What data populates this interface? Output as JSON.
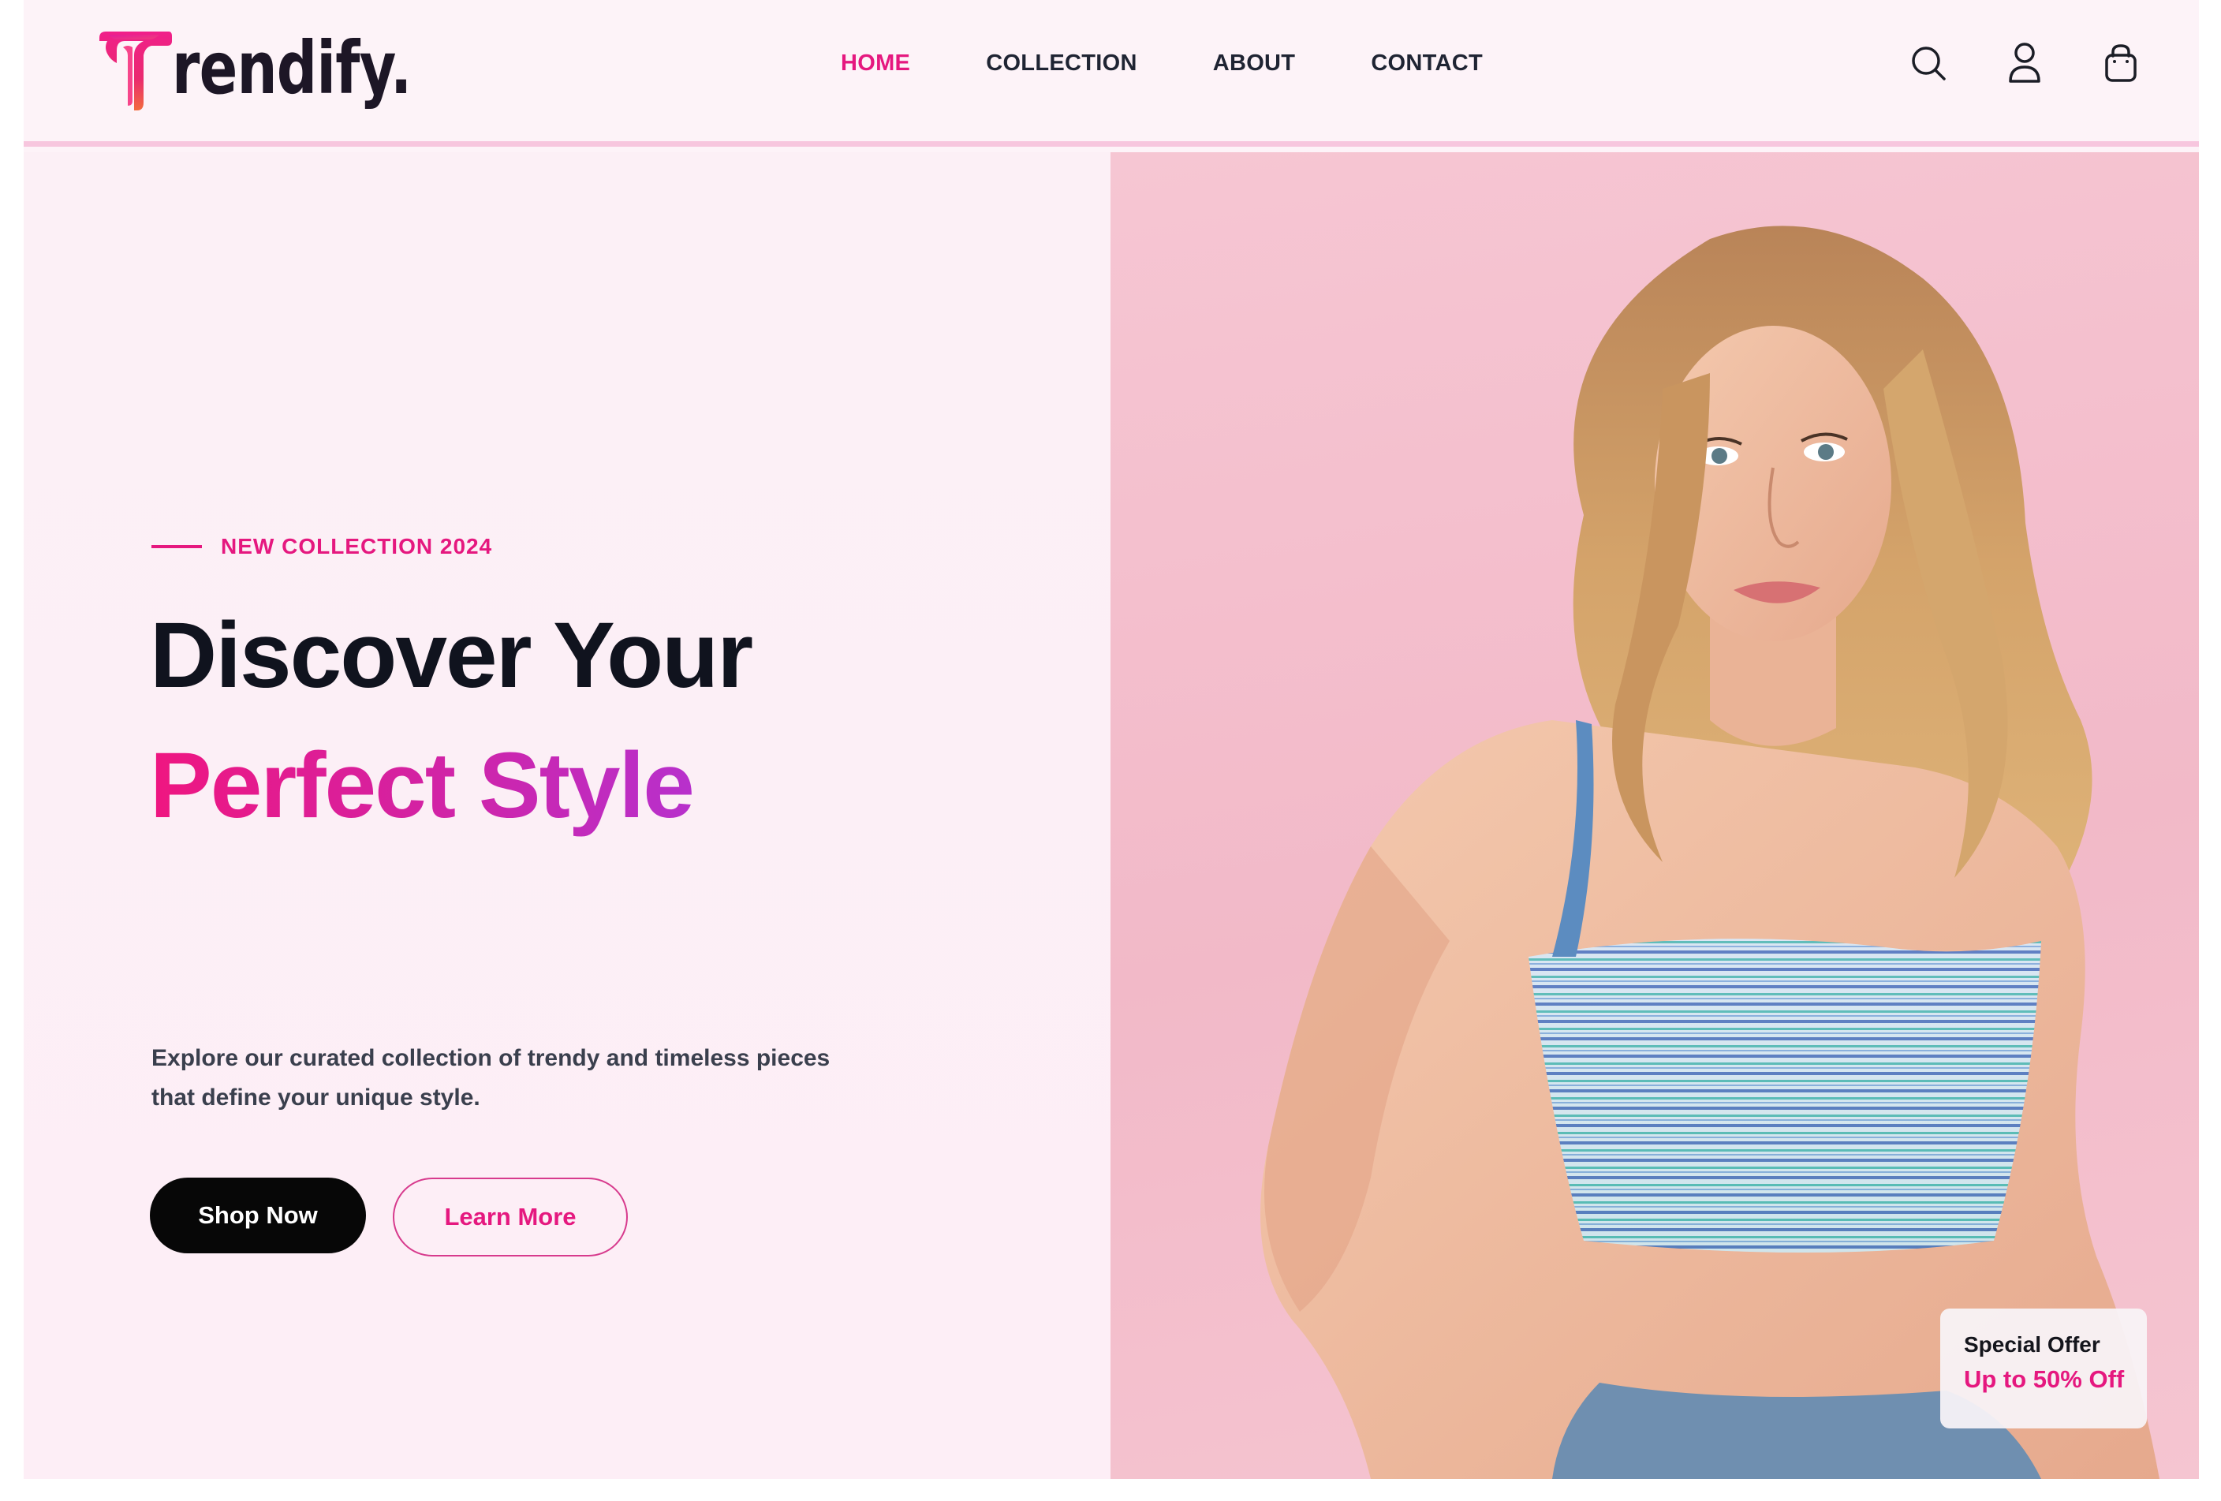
{
  "brand": {
    "logo_text": "rendify.",
    "logo_alt": "T",
    "accent": "#e5187f",
    "accent_purple": "#b730cc",
    "dark": "#10131e"
  },
  "nav": {
    "links": [
      {
        "label": "HOME",
        "active": true
      },
      {
        "label": "COLLECTION",
        "active": false
      },
      {
        "label": "ABOUT",
        "active": false
      },
      {
        "label": "CONTACT",
        "active": false
      }
    ],
    "icons": [
      "search-icon",
      "user-icon",
      "shopping-bag-icon"
    ]
  },
  "hero": {
    "eyebrow": "NEW COLLECTION 2024",
    "title_line1": "Discover Your",
    "title_line2": "Perfect Style",
    "description": "Explore our curated collection of trendy and timeless pieces that define your unique style.",
    "primary_button": "Shop Now",
    "secondary_button": "Learn More",
    "background_color": "#f4bfcd"
  },
  "offer": {
    "title": "Special Offer",
    "subtitle": "Up to 50% Off"
  }
}
